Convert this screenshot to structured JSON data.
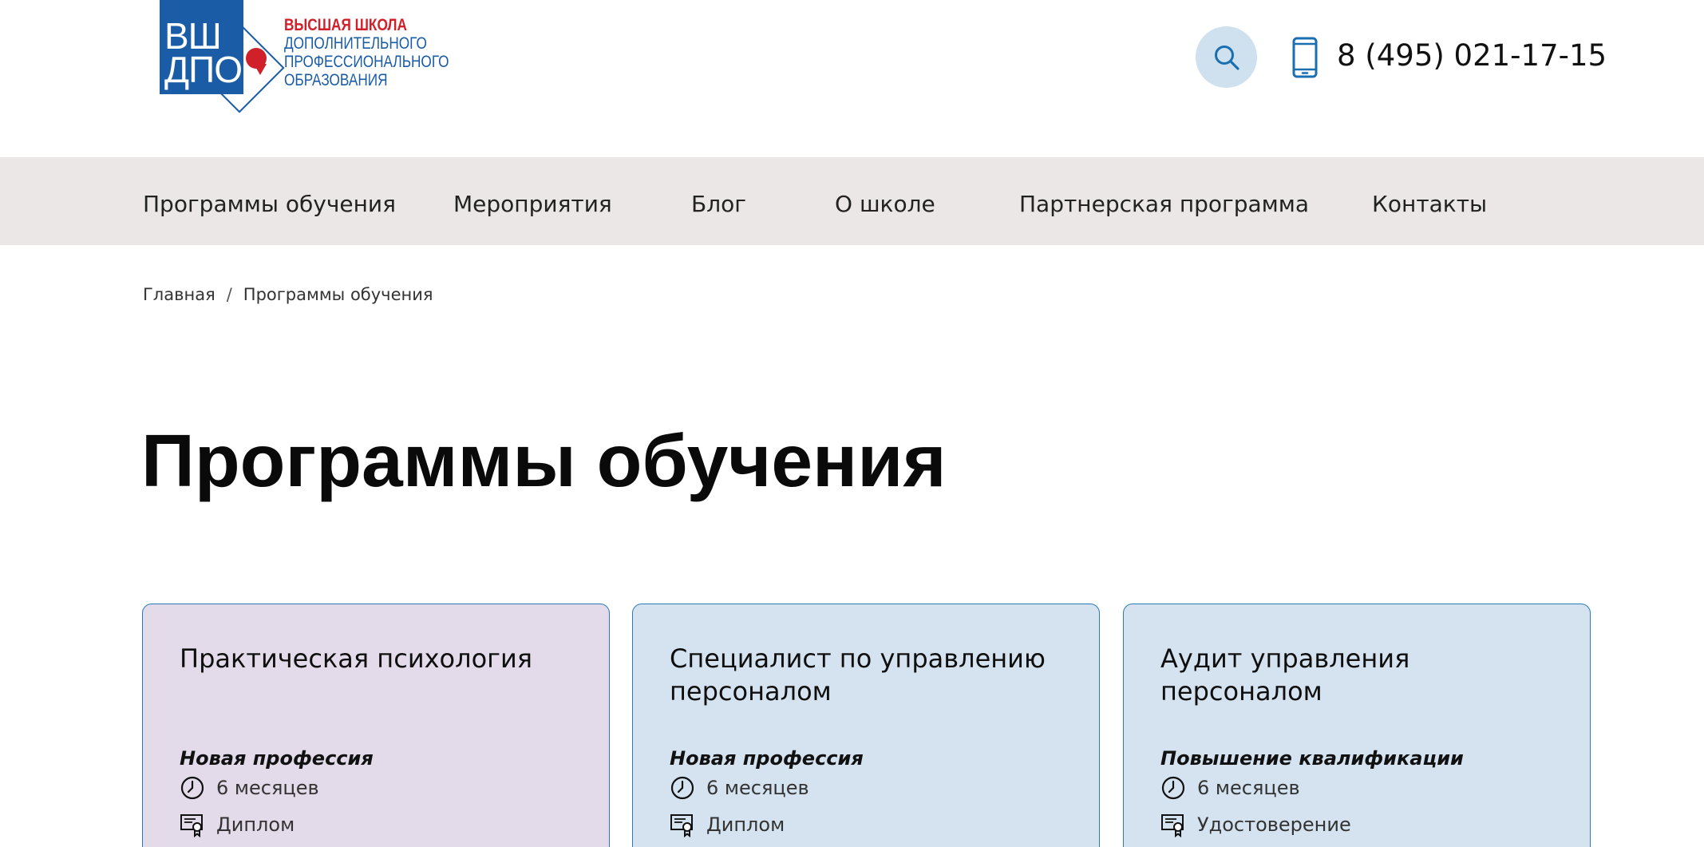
{
  "header": {
    "logo": {
      "mark_line1": "ВШ",
      "mark_line2": "ДПО",
      "text_line1": "ВЫСШАЯ ШКОЛА",
      "text_line2": "ДОПОЛНИТЕЛЬНОГО",
      "text_line3": "ПРОФЕССИОНАЛЬНОГО",
      "text_line4": "ОБРАЗОВАНИЯ"
    },
    "search_icon": "search-icon",
    "phone_icon": "mobile-phone-icon",
    "phone": "8 (495) 021-17-15"
  },
  "nav": {
    "items": [
      {
        "label": "Программы обучения"
      },
      {
        "label": "Мероприятия"
      },
      {
        "label": "Блог"
      },
      {
        "label": "О школе"
      },
      {
        "label": "Партнерская программа"
      },
      {
        "label": "Контакты"
      }
    ]
  },
  "breadcrumb": {
    "home": "Главная",
    "separator": "/",
    "current": "Программы обучения"
  },
  "page": {
    "title": "Программы обучения"
  },
  "cards": [
    {
      "title": "Практическая психология",
      "type": "Новая профессия",
      "duration": "6 месяцев",
      "document": "Диплом",
      "background": "#e3dbea"
    },
    {
      "title": "Специалист по управлению персоналом",
      "type": "Новая профессия",
      "duration": "6 месяцев",
      "document": "Диплом",
      "background": "#d5e3f0"
    },
    {
      "title": "Аудит управления персоналом",
      "type": "Повышение квалификации",
      "duration": "6 месяцев",
      "document": "Удостоверение",
      "background": "#d5e3f0"
    }
  ],
  "colors": {
    "brand_blue": "#1a5ca6",
    "brand_red": "#d0202a",
    "nav_background": "#ebe7e6",
    "card_border": "#2a7bb5",
    "search_circle": "#cfe1ef"
  }
}
